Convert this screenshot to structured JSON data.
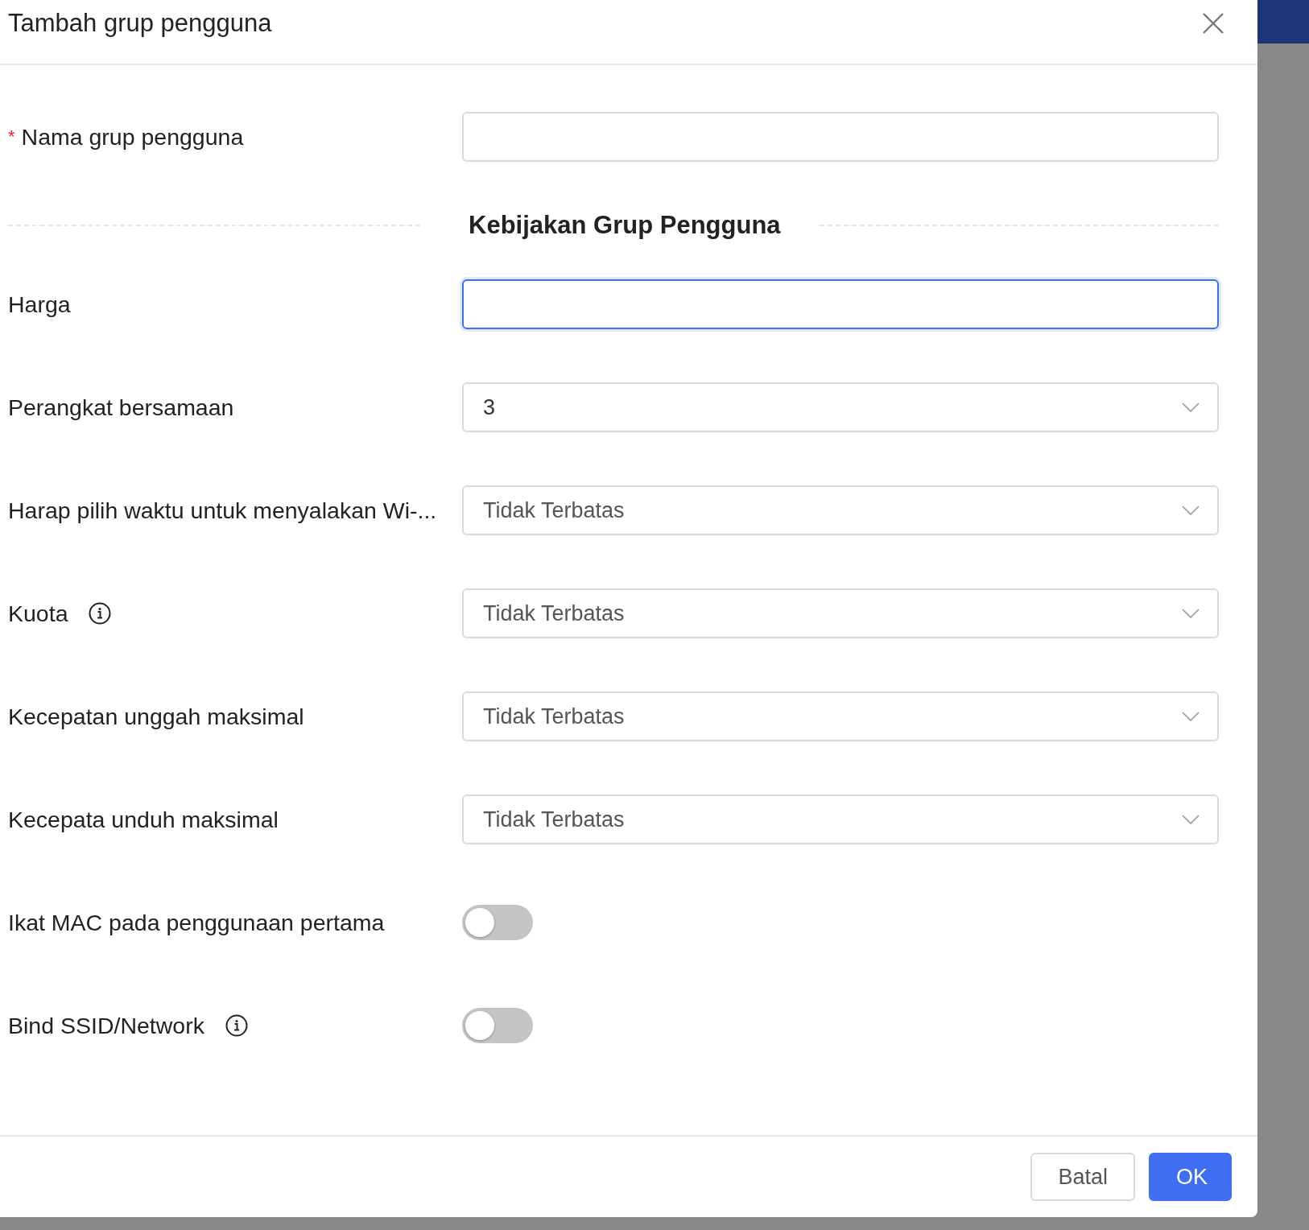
{
  "dialog": {
    "title": "Tambah grup pengguna"
  },
  "fields": [
    {
      "kind": "text",
      "label": "Nama grup pengguna",
      "required_mark": "*",
      "focused": false
    },
    {
      "kind": "section",
      "label": "Kebijakan Grup Pengguna"
    },
    {
      "kind": "text",
      "label": "Harga",
      "focused": true
    },
    {
      "kind": "select",
      "label": "Perangkat bersamaan",
      "value": "3"
    },
    {
      "kind": "select",
      "label": "Harap pilih waktu untuk menyalakan Wi-...",
      "value": "Tidak Terbatas"
    },
    {
      "kind": "select",
      "label": "Kuota",
      "info": true,
      "value": "Tidak Terbatas"
    },
    {
      "kind": "select",
      "label": "Kecepatan unggah maksimal",
      "value": "Tidak Terbatas"
    },
    {
      "kind": "select",
      "label": "Kecepata unduh maksimal",
      "value": "Tidak Terbatas"
    },
    {
      "kind": "toggle",
      "label": "Ikat MAC pada penggunaan pertama",
      "on": false
    },
    {
      "kind": "toggle",
      "label": "Bind SSID/Network",
      "info": true,
      "on": false
    }
  ],
  "buttons": [
    {
      "label": "Batal",
      "primary": false
    },
    {
      "label": "OK",
      "primary": true
    }
  ]
}
